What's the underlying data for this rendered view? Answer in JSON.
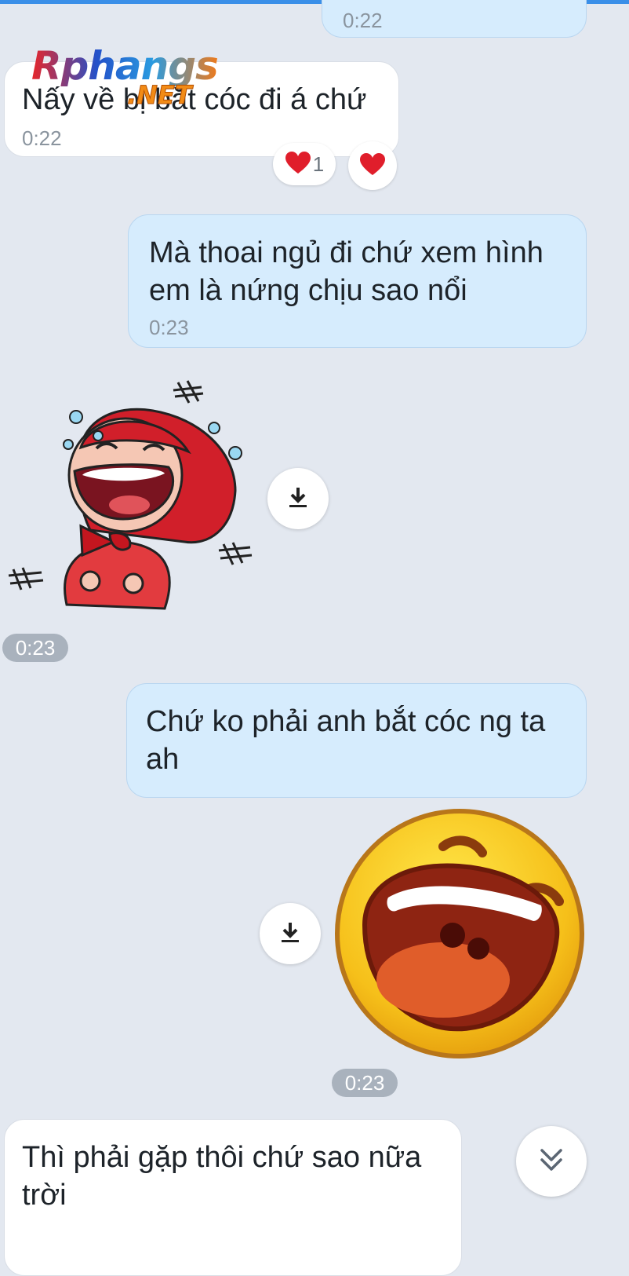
{
  "watermark": {
    "main": "Rphangs",
    "sub": ".NET"
  },
  "messages": [
    {
      "time": "0:22"
    },
    {
      "text": "Nấy về bị bắt cóc đi á chứ",
      "time": "0:22",
      "reactions": {
        "count": "1"
      }
    },
    {
      "text": "Mà thoai ngủ đi chứ xem hình em là nứng chịu sao nổi",
      "time": "0:23"
    },
    {
      "time": "0:23"
    },
    {
      "text": "Chứ ko phải anh bắt cóc ng ta ah"
    },
    {
      "time": "0:23"
    },
    {
      "text": "Thì phải gặp thôi chứ sao nữa trời"
    }
  ],
  "icons": {
    "download": "download-icon",
    "heart": "heart-icon",
    "scroll_down": "chevron-double-down-icon"
  },
  "colors": {
    "accent": "#3a8fe8",
    "outgoing_bubble": "#d6ecfd",
    "incoming_bubble": "#ffffff",
    "background": "#e3e8f0"
  }
}
